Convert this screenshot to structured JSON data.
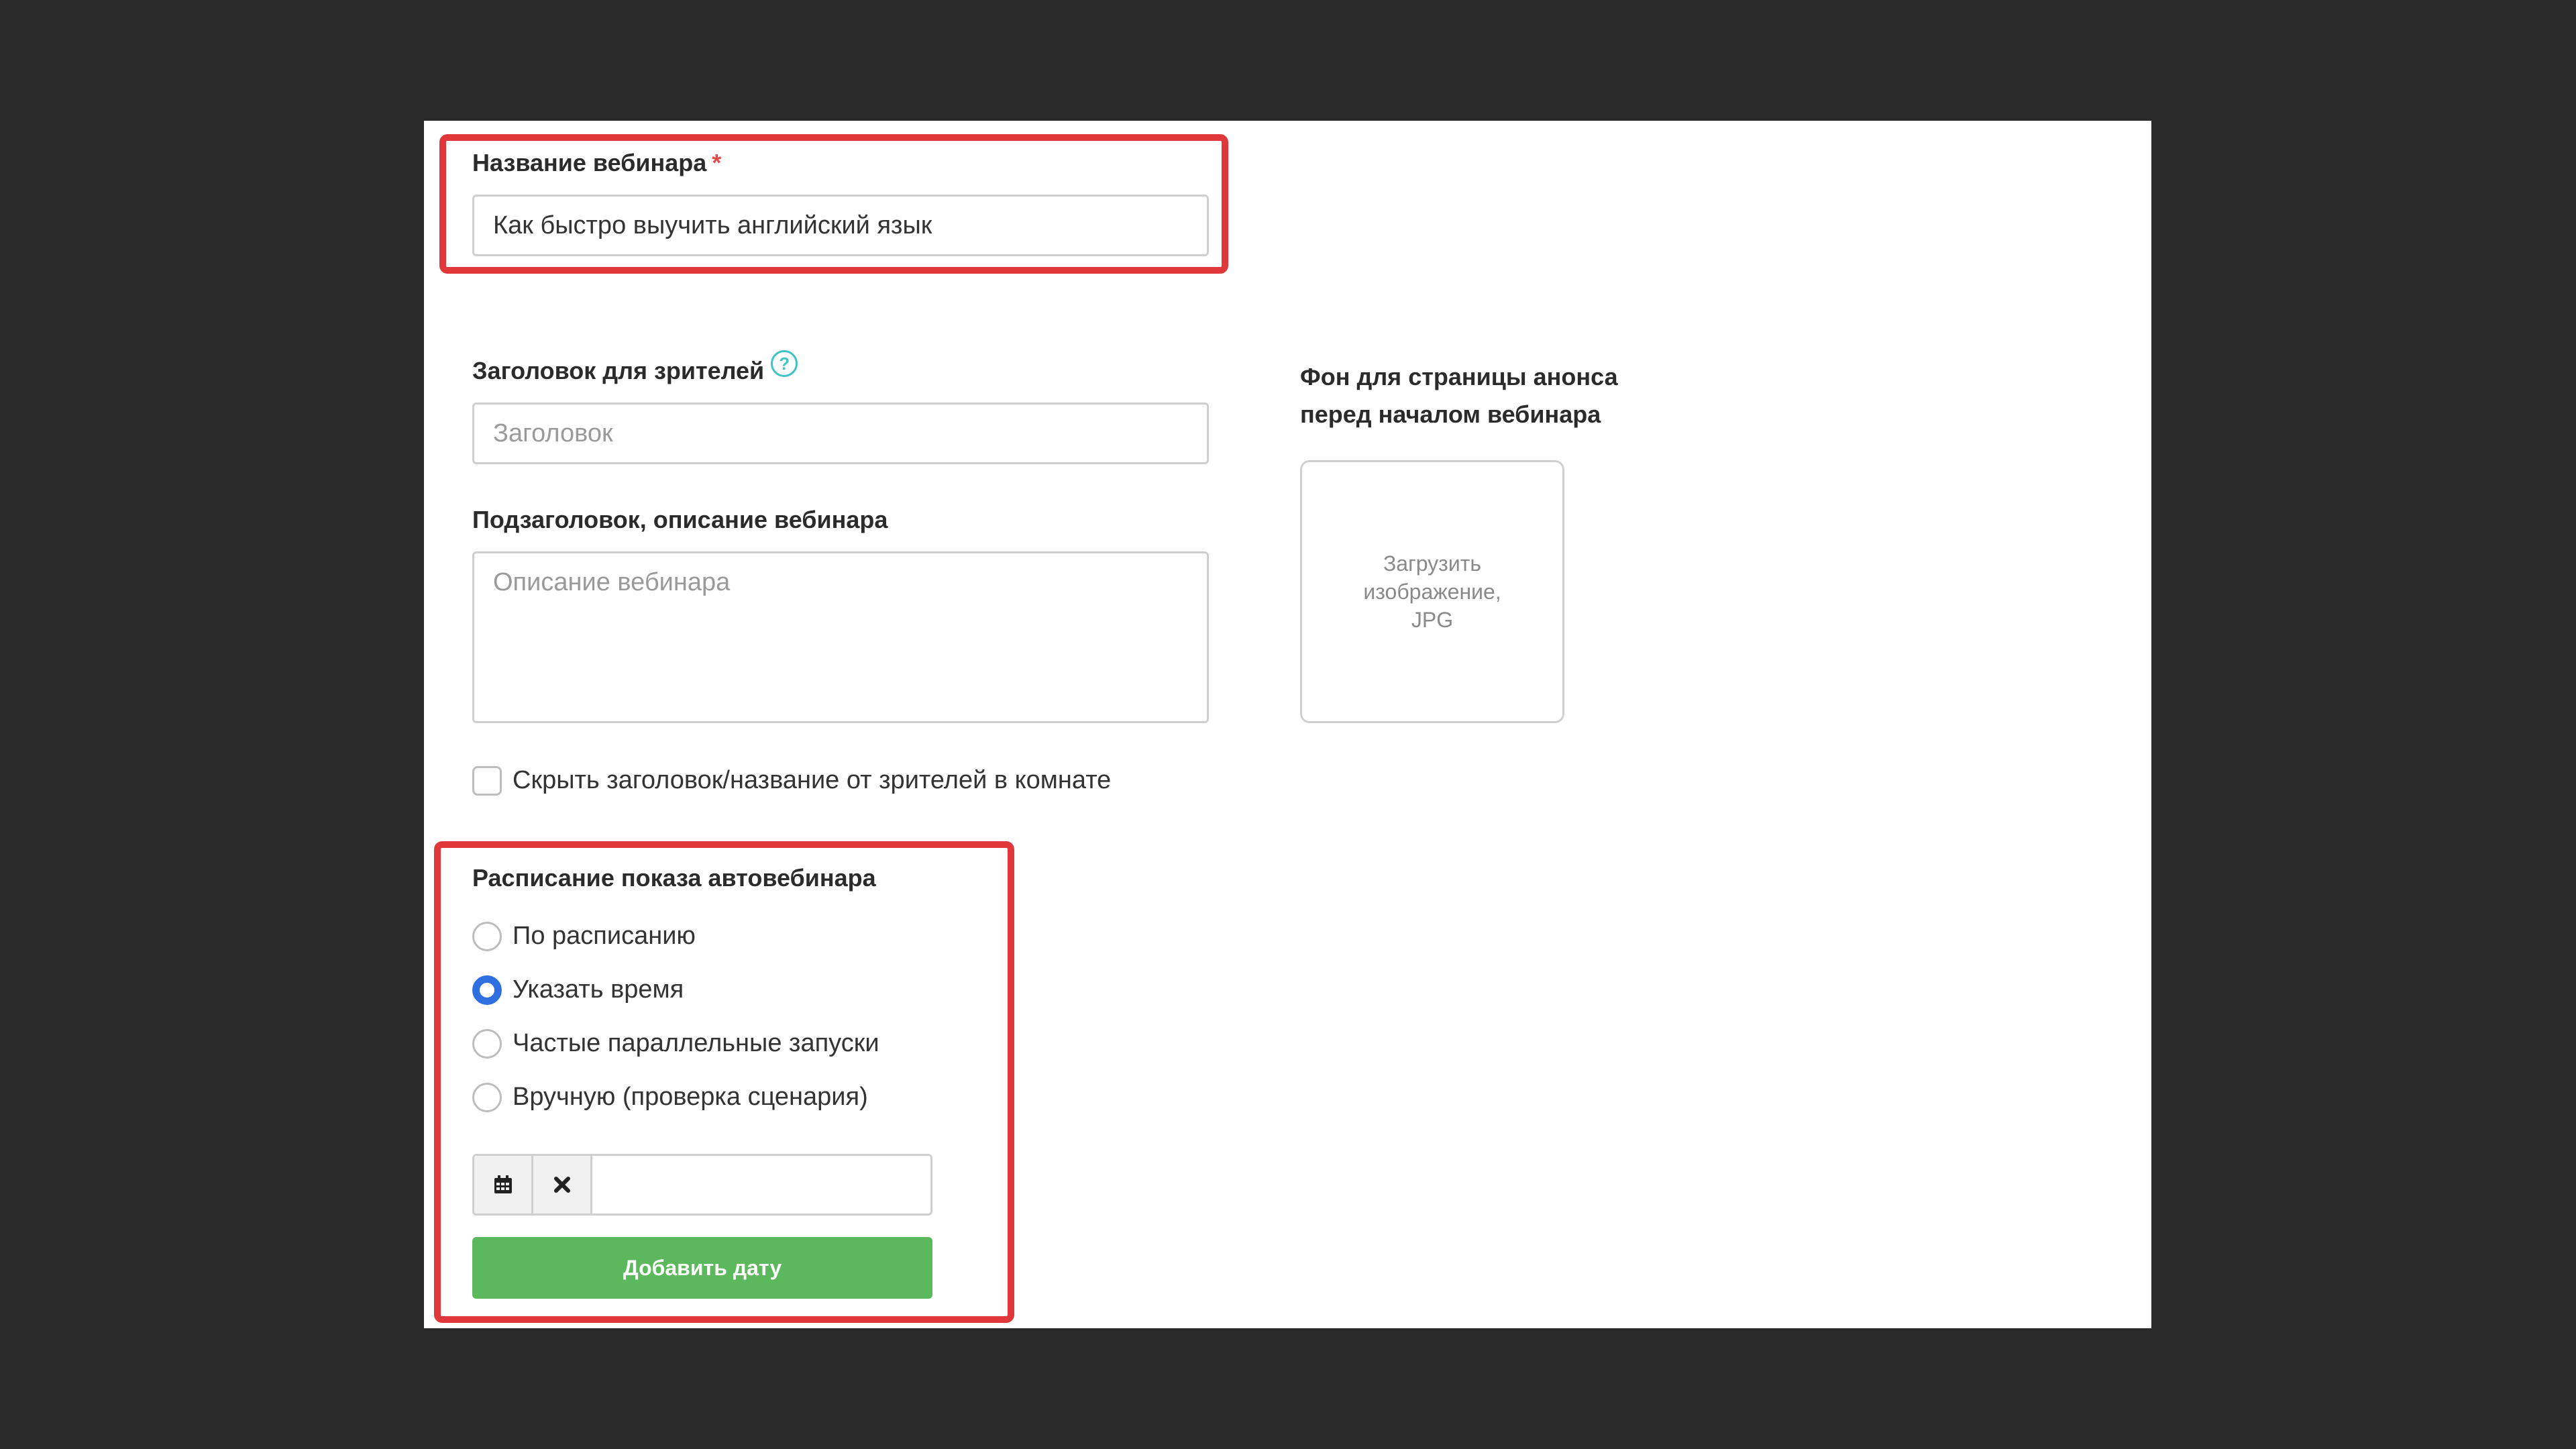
{
  "form": {
    "webinar_name": {
      "label": "Название вебинара",
      "required_mark": "*",
      "value": "Как быстро выучить английский язык"
    },
    "viewer_title": {
      "label": "Заголовок для зрителей",
      "help_mark": "?",
      "placeholder": "Заголовок"
    },
    "subtitle": {
      "label": "Подзаголовок, описание вебинара",
      "placeholder": "Описание вебинара"
    },
    "background": {
      "label_line1": "Фон для страницы анонса",
      "label_line2": "перед началом вебинара",
      "upload_line1": "Загрузить",
      "upload_line2": "изображение,",
      "upload_line3": "JPG"
    },
    "hide_title_checkbox": {
      "label": "Скрыть заголовок/название от зрителей в комнате",
      "checked": false
    },
    "schedule": {
      "title": "Расписание показа автовебинара",
      "options": [
        {
          "label": "По расписанию",
          "selected": false
        },
        {
          "label": "Указать время",
          "selected": true
        },
        {
          "label": "Частые параллельные запуски",
          "selected": false
        },
        {
          "label": "Вручную (проверка сценария)",
          "selected": false
        }
      ],
      "date_value": "",
      "calendar_icon": "calendar-icon",
      "clear_icon": "close-icon",
      "add_date_label": "Добавить дату"
    }
  },
  "colors": {
    "highlight": "#e0373a",
    "accent": "#2f6fe0",
    "button_green": "#5cb85c",
    "help": "#3ec3c7"
  }
}
